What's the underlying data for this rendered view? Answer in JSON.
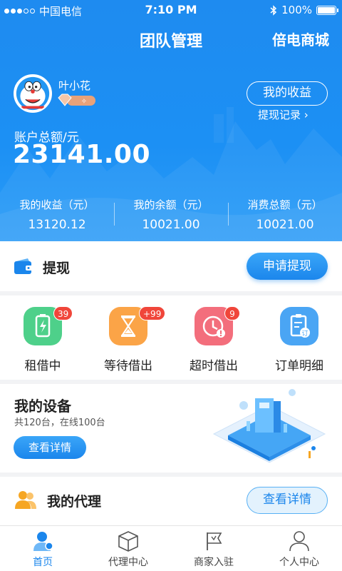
{
  "status_bar": {
    "carrier": "中国电信",
    "time": "7:10 PM",
    "battery": "100%"
  },
  "header": {
    "title": "团队管理",
    "right_link": "倍电商城"
  },
  "user": {
    "name": "叶小花",
    "my_earnings_button": "我的收益",
    "withdraw_record_link": "提现记录"
  },
  "account": {
    "label": "账户总额/元",
    "value": "23141.00"
  },
  "stats": [
    {
      "label": "我的收益（元）",
      "value": "13120.12"
    },
    {
      "label": "我的余额（元）",
      "value": "10021.00"
    },
    {
      "label": "消费总额（元）",
      "value": "10021.00"
    }
  ],
  "withdraw": {
    "title": "提现",
    "button": "申请提现"
  },
  "grid": [
    {
      "label": "租借中",
      "count": "39",
      "icon": "battery-icon",
      "color": "#4ed08a"
    },
    {
      "label": "等待借出",
      "count": "+99",
      "icon": "hourglass-icon",
      "color": "#fba447"
    },
    {
      "label": "超时借出",
      "count": "9",
      "icon": "clock-alert-icon",
      "color": "#f36e7c"
    },
    {
      "label": "订单明细",
      "count": "",
      "icon": "order-detail-icon",
      "color": "#4aa5f4"
    }
  ],
  "devices": {
    "title": "我的设备",
    "subtitle": "共120台，在线100台",
    "button": "查看详情"
  },
  "agent": {
    "title": "我的代理",
    "button": "查看详情"
  },
  "tabs": [
    {
      "label": "首页",
      "icon": "home-person-icon",
      "active": true
    },
    {
      "label": "代理中心",
      "icon": "box-icon",
      "active": false
    },
    {
      "label": "商家入驻",
      "icon": "flag-store-icon",
      "active": false
    },
    {
      "label": "个人中心",
      "icon": "person-icon",
      "active": false
    }
  ],
  "colors": {
    "primary": "#1b86ec",
    "badge": "#f0463a"
  }
}
